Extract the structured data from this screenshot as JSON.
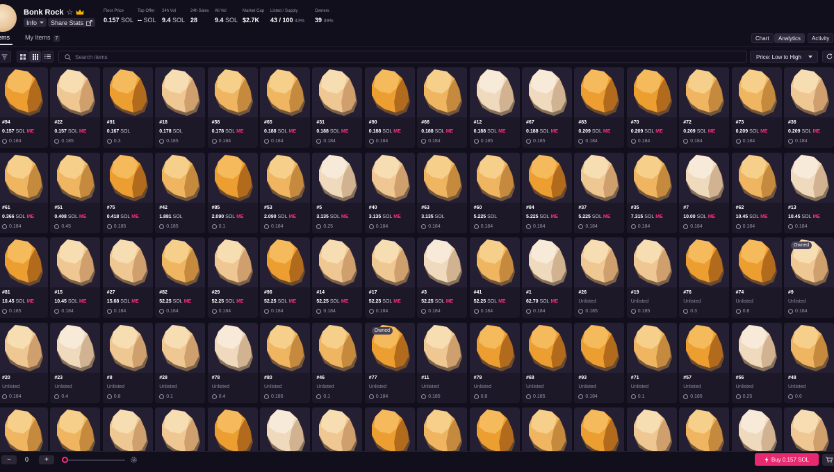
{
  "header": {
    "title": "Bonk Rock",
    "info_label": "Info",
    "share_label": "Share Stats",
    "stats": [
      {
        "label": "Floor Price",
        "value": "0.157",
        "unit": "SOL",
        "pct": ""
      },
      {
        "label": "Top Offer",
        "value": "--",
        "unit": "SOL",
        "pct": ""
      },
      {
        "label": "24h Vol",
        "value": "9.4",
        "unit": "SOL",
        "pct": ""
      },
      {
        "label": "24h Sales",
        "value": "28",
        "unit": "",
        "pct": ""
      },
      {
        "label": "All Vol",
        "value": "9.4",
        "unit": "SOL",
        "pct": ""
      },
      {
        "label": "Market Cap",
        "value": "$2.7K",
        "unit": "",
        "pct": ""
      },
      {
        "label": "Listed / Supply",
        "value": "43 / 100",
        "unit": "",
        "pct": "43%"
      },
      {
        "label": "Owners",
        "value": "39",
        "unit": "",
        "pct": "39%"
      }
    ]
  },
  "tabs": {
    "items_label": "Items",
    "my_items_label": "My Items",
    "my_items_count": "7"
  },
  "views": {
    "chart": "Chart",
    "analytics": "Analytics",
    "activity": "Activity"
  },
  "toolbar": {
    "search_placeholder": "Search items",
    "sort_label": "Price: Low to High"
  },
  "cards": [
    {
      "num": "#94",
      "price": "0.157",
      "unit": "SOL",
      "me": true,
      "offer": "0.184",
      "shade": 0,
      "owned": false
    },
    {
      "num": "#22",
      "price": "0.157",
      "unit": "SOL",
      "me": true,
      "offer": "0.185",
      "shade": 2,
      "owned": false
    },
    {
      "num": "#91",
      "price": "0.167",
      "unit": "SOL",
      "me": false,
      "offer": "0.3",
      "shade": 0,
      "owned": false
    },
    {
      "num": "#18",
      "price": "0.178",
      "unit": "SOL",
      "me": false,
      "offer": "0.185",
      "shade": 2,
      "owned": false
    },
    {
      "num": "#58",
      "price": "0.178",
      "unit": "SOL",
      "me": true,
      "offer": "0.184",
      "shade": 1,
      "owned": false
    },
    {
      "num": "#65",
      "price": "0.188",
      "unit": "SOL",
      "me": true,
      "offer": "0.184",
      "shade": 1,
      "owned": false
    },
    {
      "num": "#31",
      "price": "0.188",
      "unit": "SOL",
      "me": true,
      "offer": "0.184",
      "shade": 2,
      "owned": false
    },
    {
      "num": "#90",
      "price": "0.188",
      "unit": "SOL",
      "me": true,
      "offer": "0.184",
      "shade": 0,
      "owned": false
    },
    {
      "num": "#66",
      "price": "0.188",
      "unit": "SOL",
      "me": true,
      "offer": "0.184",
      "shade": 1,
      "owned": false
    },
    {
      "num": "#12",
      "price": "0.188",
      "unit": "SOL",
      "me": true,
      "offer": "0.185",
      "shade": 3,
      "owned": false
    },
    {
      "num": "#67",
      "price": "0.188",
      "unit": "SOL",
      "me": true,
      "offer": "0.185",
      "shade": 3,
      "owned": false
    },
    {
      "num": "#83",
      "price": "0.209",
      "unit": "SOL",
      "me": true,
      "offer": "0.184",
      "shade": 0,
      "owned": false
    },
    {
      "num": "#70",
      "price": "0.209",
      "unit": "SOL",
      "me": true,
      "offer": "0.184",
      "shade": 0,
      "owned": false
    },
    {
      "num": "#72",
      "price": "0.209",
      "unit": "SOL",
      "me": true,
      "offer": "0.184",
      "shade": 1,
      "owned": false
    },
    {
      "num": "#73",
      "price": "0.209",
      "unit": "SOL",
      "me": true,
      "offer": "0.184",
      "shade": 1,
      "owned": false
    },
    {
      "num": "#36",
      "price": "0.209",
      "unit": "SOL",
      "me": true,
      "offer": "0.184",
      "shade": 2,
      "owned": false
    },
    {
      "num": "#61",
      "price": "0.366",
      "unit": "SOL",
      "me": true,
      "offer": "0.184",
      "shade": 1,
      "owned": false
    },
    {
      "num": "#51",
      "price": "0.408",
      "unit": "SOL",
      "me": true,
      "offer": "0.45",
      "shade": 1,
      "owned": false
    },
    {
      "num": "#75",
      "price": "0.418",
      "unit": "SOL",
      "me": true,
      "offer": "0.185",
      "shade": 0,
      "owned": false
    },
    {
      "num": "#42",
      "price": "1.881",
      "unit": "SOL",
      "me": false,
      "offer": "0.185",
      "shade": 1,
      "owned": false
    },
    {
      "num": "#85",
      "price": "2.090",
      "unit": "SOL",
      "me": true,
      "offer": "0.1",
      "shade": 0,
      "owned": false
    },
    {
      "num": "#53",
      "price": "2.090",
      "unit": "SOL",
      "me": true,
      "offer": "0.184",
      "shade": 1,
      "owned": false
    },
    {
      "num": "#5",
      "price": "3.135",
      "unit": "SOL",
      "me": true,
      "offer": "0.25",
      "shade": 3,
      "owned": false
    },
    {
      "num": "#40",
      "price": "3.135",
      "unit": "SOL",
      "me": true,
      "offer": "0.184",
      "shade": 2,
      "owned": false
    },
    {
      "num": "#63",
      "price": "3.135",
      "unit": "SOL",
      "me": false,
      "offer": "0.184",
      "shade": 1,
      "owned": false
    },
    {
      "num": "#60",
      "price": "5.225",
      "unit": "SOL",
      "me": false,
      "offer": "0.184",
      "shade": 1,
      "owned": false
    },
    {
      "num": "#84",
      "price": "5.225",
      "unit": "SOL",
      "me": true,
      "offer": "0.184",
      "shade": 0,
      "owned": false
    },
    {
      "num": "#37",
      "price": "5.225",
      "unit": "SOL",
      "me": true,
      "offer": "0.184",
      "shade": 2,
      "owned": false
    },
    {
      "num": "#35",
      "price": "7.315",
      "unit": "SOL",
      "me": true,
      "offer": "0.184",
      "shade": 1,
      "owned": false
    },
    {
      "num": "#7",
      "price": "10.00",
      "unit": "SOL",
      "me": true,
      "offer": "0.184",
      "shade": 3,
      "owned": false
    },
    {
      "num": "#62",
      "price": "10.45",
      "unit": "SOL",
      "me": true,
      "offer": "0.184",
      "shade": 1,
      "owned": false
    },
    {
      "num": "#13",
      "price": "10.45",
      "unit": "SOL",
      "me": true,
      "offer": "0.184",
      "shade": 3,
      "owned": false
    },
    {
      "num": "#81",
      "price": "10.45",
      "unit": "SOL",
      "me": true,
      "offer": "0.185",
      "shade": 0,
      "owned": false
    },
    {
      "num": "#15",
      "price": "10.45",
      "unit": "SOL",
      "me": true,
      "offer": "0.184",
      "shade": 2,
      "owned": false
    },
    {
      "num": "#27",
      "price": "15.68",
      "unit": "SOL",
      "me": true,
      "offer": "0.184",
      "shade": 2,
      "owned": false
    },
    {
      "num": "#82",
      "price": "52.25",
      "unit": "SOL",
      "me": true,
      "offer": "0.184",
      "shade": 1,
      "owned": false
    },
    {
      "num": "#29",
      "price": "52.25",
      "unit": "SOL",
      "me": true,
      "offer": "0.184",
      "shade": 2,
      "owned": false
    },
    {
      "num": "#96",
      "price": "52.25",
      "unit": "SOL",
      "me": true,
      "offer": "0.184",
      "shade": 0,
      "owned": false
    },
    {
      "num": "#14",
      "price": "52.25",
      "unit": "SOL",
      "me": true,
      "offer": "0.184",
      "shade": 2,
      "owned": false
    },
    {
      "num": "#17",
      "price": "52.25",
      "unit": "SOL",
      "me": true,
      "offer": "0.184",
      "shade": 2,
      "owned": false
    },
    {
      "num": "#3",
      "price": "52.25",
      "unit": "SOL",
      "me": true,
      "offer": "0.184",
      "shade": 3,
      "owned": false
    },
    {
      "num": "#41",
      "price": "52.25",
      "unit": "SOL",
      "me": true,
      "offer": "0.184",
      "shade": 1,
      "owned": false
    },
    {
      "num": "#1",
      "price": "62.70",
      "unit": "SOL",
      "me": true,
      "offer": "0.184",
      "shade": 3,
      "owned": false
    },
    {
      "num": "#26",
      "price": "Unlisted",
      "unit": "",
      "me": false,
      "offer": "0.185",
      "shade": 2,
      "owned": false
    },
    {
      "num": "#19",
      "price": "Unlisted",
      "unit": "",
      "me": false,
      "offer": "0.185",
      "shade": 2,
      "owned": false
    },
    {
      "num": "#76",
      "price": "Unlisted",
      "unit": "",
      "me": false,
      "offer": "0.3",
      "shade": 0,
      "owned": false
    },
    {
      "num": "#74",
      "price": "Unlisted",
      "unit": "",
      "me": false,
      "offer": "0.8",
      "shade": 0,
      "owned": false
    },
    {
      "num": "#9",
      "price": "Unlisted",
      "unit": "",
      "me": false,
      "offer": "0.184",
      "shade": 2,
      "owned": true
    },
    {
      "num": "#20",
      "price": "Unlisted",
      "unit": "",
      "me": false,
      "offer": "0.184",
      "shade": 2,
      "owned": false
    },
    {
      "num": "#23",
      "price": "Unlisted",
      "unit": "",
      "me": false,
      "offer": "0.4",
      "shade": 3,
      "owned": false
    },
    {
      "num": "#8",
      "price": "Unlisted",
      "unit": "",
      "me": false,
      "offer": "0.8",
      "shade": 2,
      "owned": false
    },
    {
      "num": "#28",
      "price": "Unlisted",
      "unit": "",
      "me": false,
      "offer": "0.1",
      "shade": 2,
      "owned": false
    },
    {
      "num": "#78",
      "price": "Unlisted",
      "unit": "",
      "me": false,
      "offer": "0.4",
      "shade": 3,
      "owned": false
    },
    {
      "num": "#80",
      "price": "Unlisted",
      "unit": "",
      "me": false,
      "offer": "0.185",
      "shade": 1,
      "owned": false
    },
    {
      "num": "#46",
      "price": "Unlisted",
      "unit": "",
      "me": false,
      "offer": "0.1",
      "shade": 1,
      "owned": false
    },
    {
      "num": "#77",
      "price": "Unlisted",
      "unit": "",
      "me": false,
      "offer": "0.184",
      "shade": 0,
      "owned": true
    },
    {
      "num": "#11",
      "price": "Unlisted",
      "unit": "",
      "me": false,
      "offer": "0.185",
      "shade": 2,
      "owned": false
    },
    {
      "num": "#79",
      "price": "Unlisted",
      "unit": "",
      "me": false,
      "offer": "0.8",
      "shade": 0,
      "owned": false
    },
    {
      "num": "#68",
      "price": "Unlisted",
      "unit": "",
      "me": false,
      "offer": "0.185",
      "shade": 0,
      "owned": false
    },
    {
      "num": "#93",
      "price": "Unlisted",
      "unit": "",
      "me": false,
      "offer": "0.184",
      "shade": 0,
      "owned": false
    },
    {
      "num": "#71",
      "price": "Unlisted",
      "unit": "",
      "me": false,
      "offer": "0.1",
      "shade": 1,
      "owned": false
    },
    {
      "num": "#57",
      "price": "Unlisted",
      "unit": "",
      "me": false,
      "offer": "0.185",
      "shade": 0,
      "owned": false
    },
    {
      "num": "#56",
      "price": "Unlisted",
      "unit": "",
      "me": false,
      "offer": "0.25",
      "shade": 3,
      "owned": false
    },
    {
      "num": "#48",
      "price": "Unlisted",
      "unit": "",
      "me": false,
      "offer": "0.6",
      "shade": 1,
      "owned": false
    },
    {
      "num": "",
      "price": "",
      "unit": "",
      "me": false,
      "offer": "",
      "shade": 1,
      "owned": false
    },
    {
      "num": "",
      "price": "",
      "unit": "",
      "me": false,
      "offer": "",
      "shade": 1,
      "owned": false
    },
    {
      "num": "",
      "price": "",
      "unit": "",
      "me": false,
      "offer": "",
      "shade": 2,
      "owned": false
    },
    {
      "num": "",
      "price": "",
      "unit": "",
      "me": false,
      "offer": "",
      "shade": 2,
      "owned": false
    },
    {
      "num": "",
      "price": "",
      "unit": "",
      "me": false,
      "offer": "",
      "shade": 0,
      "owned": false
    },
    {
      "num": "",
      "price": "",
      "unit": "",
      "me": false,
      "offer": "",
      "shade": 3,
      "owned": false
    },
    {
      "num": "",
      "price": "",
      "unit": "",
      "me": false,
      "offer": "",
      "shade": 2,
      "owned": false
    },
    {
      "num": "",
      "price": "",
      "unit": "",
      "me": false,
      "offer": "",
      "shade": 0,
      "owned": false
    },
    {
      "num": "",
      "price": "",
      "unit": "",
      "me": false,
      "offer": "",
      "shade": 1,
      "owned": false
    },
    {
      "num": "",
      "price": "",
      "unit": "",
      "me": false,
      "offer": "",
      "shade": 0,
      "owned": false
    },
    {
      "num": "",
      "price": "",
      "unit": "",
      "me": false,
      "offer": "",
      "shade": 1,
      "owned": false
    },
    {
      "num": "",
      "price": "",
      "unit": "",
      "me": false,
      "offer": "",
      "shade": 0,
      "owned": false
    },
    {
      "num": "",
      "price": "",
      "unit": "",
      "me": false,
      "offer": "",
      "shade": 2,
      "owned": false
    },
    {
      "num": "",
      "price": "",
      "unit": "",
      "me": false,
      "offer": "",
      "shade": 1,
      "owned": false
    },
    {
      "num": "",
      "price": "",
      "unit": "",
      "me": false,
      "offer": "",
      "shade": 3,
      "owned": false
    },
    {
      "num": "",
      "price": "",
      "unit": "",
      "me": false,
      "offer": "",
      "shade": 2,
      "owned": false
    }
  ],
  "card_labels": {
    "owned": "Owned",
    "me": "ME"
  },
  "rock_palettes": [
    {
      "light": "#f5ba5c",
      "mid": "#ec9e31",
      "dark": "#b26b1c",
      "shadow": "#6b4a2e"
    },
    {
      "light": "#f6cf8a",
      "mid": "#eeb560",
      "dark": "#c58a3e",
      "shadow": "#73573a"
    },
    {
      "light": "#f7ddb2",
      "mid": "#eec792",
      "dark": "#cfa06e",
      "shadow": "#7c6248"
    },
    {
      "light": "#f8ead8",
      "mid": "#efd9bd",
      "dark": "#d1b392",
      "shadow": "#86715b"
    }
  ],
  "footer": {
    "minus": "−",
    "plus": "+",
    "quantity": "0",
    "buy_label": "Buy 0.157 SOL"
  },
  "colors": {
    "accent": "#e8286f",
    "background": "#120f1d",
    "card": "#1c1828"
  }
}
